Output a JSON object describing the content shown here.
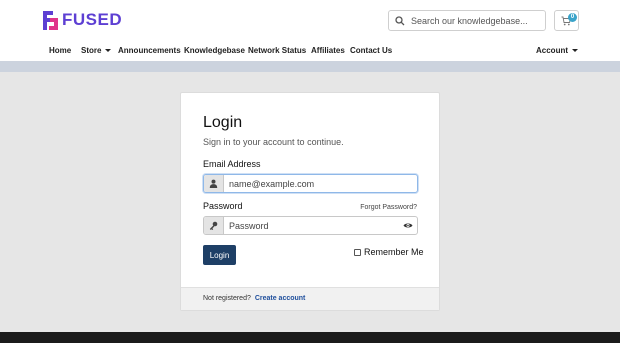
{
  "brand": {
    "name": "FUSED",
    "colors": {
      "primary": "#5d3fd3",
      "secondary": "#e0348a",
      "accent": "#3aa3c9"
    }
  },
  "search": {
    "placeholder": "Search our knowledgebase..."
  },
  "cart": {
    "count": "0"
  },
  "nav": {
    "items": [
      {
        "label": "Home"
      },
      {
        "label": "Store"
      },
      {
        "label": "Announcements"
      },
      {
        "label": "Knowledgebase"
      },
      {
        "label": "Network Status"
      },
      {
        "label": "Affiliates"
      },
      {
        "label": "Contact Us"
      }
    ],
    "account": "Account"
  },
  "login": {
    "title": "Login",
    "subtitle": "Sign in to your account to continue.",
    "email_label": "Email Address",
    "email_placeholder": "name@example.com",
    "password_label": "Password",
    "password_placeholder": "Password",
    "forgot": "Forgot Password?",
    "button": "Login",
    "remember": "Remember Me",
    "footer_text": "Not registered?",
    "create_link": "Create account"
  },
  "icons": {
    "search": "search-icon",
    "cart": "cart-icon",
    "user": "user-icon",
    "key": "key-icon",
    "eye": "eye-icon"
  }
}
